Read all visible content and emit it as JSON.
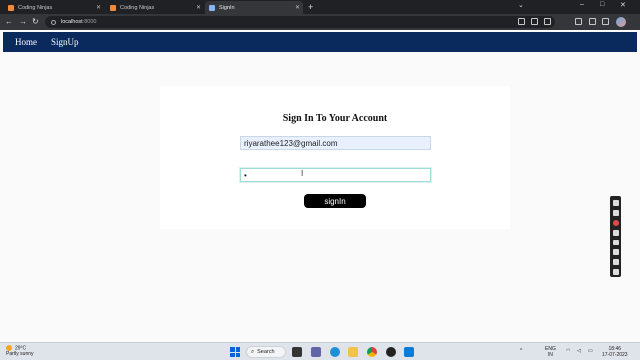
{
  "browser": {
    "tabs": [
      {
        "label": "Coding Ninjas",
        "active": false
      },
      {
        "label": "Coding Ninjas",
        "active": false
      },
      {
        "label": "SignIn",
        "active": true
      }
    ],
    "url": "localhost",
    "url_port": ":8000"
  },
  "nav": {
    "links": [
      "Home",
      "SignUp"
    ]
  },
  "form": {
    "title": "Sign In To Your Account",
    "email_value": "riyarathee123@gmail.com",
    "password_value": "•",
    "button_label": "signIn"
  },
  "taskbar": {
    "temperature": "29°C",
    "weather": "Partly sunny",
    "search_label": "Search",
    "language": "ENG",
    "region": "IN",
    "time": "18:46",
    "date": "17-07-2023"
  },
  "colors": {
    "navbar": "#0a2a5e",
    "button": "#000000",
    "email_autofill": "#e8f0fe"
  }
}
